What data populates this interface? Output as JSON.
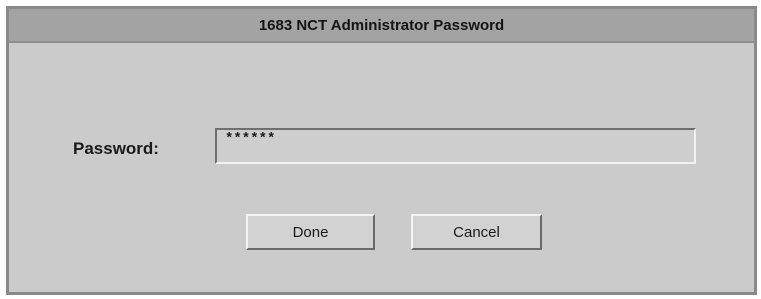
{
  "dialog": {
    "title": "1683 NCT Administrator Password"
  },
  "form": {
    "password_label": "Password:",
    "password_value": "******"
  },
  "buttons": {
    "done_label": "Done",
    "cancel_label": "Cancel"
  }
}
